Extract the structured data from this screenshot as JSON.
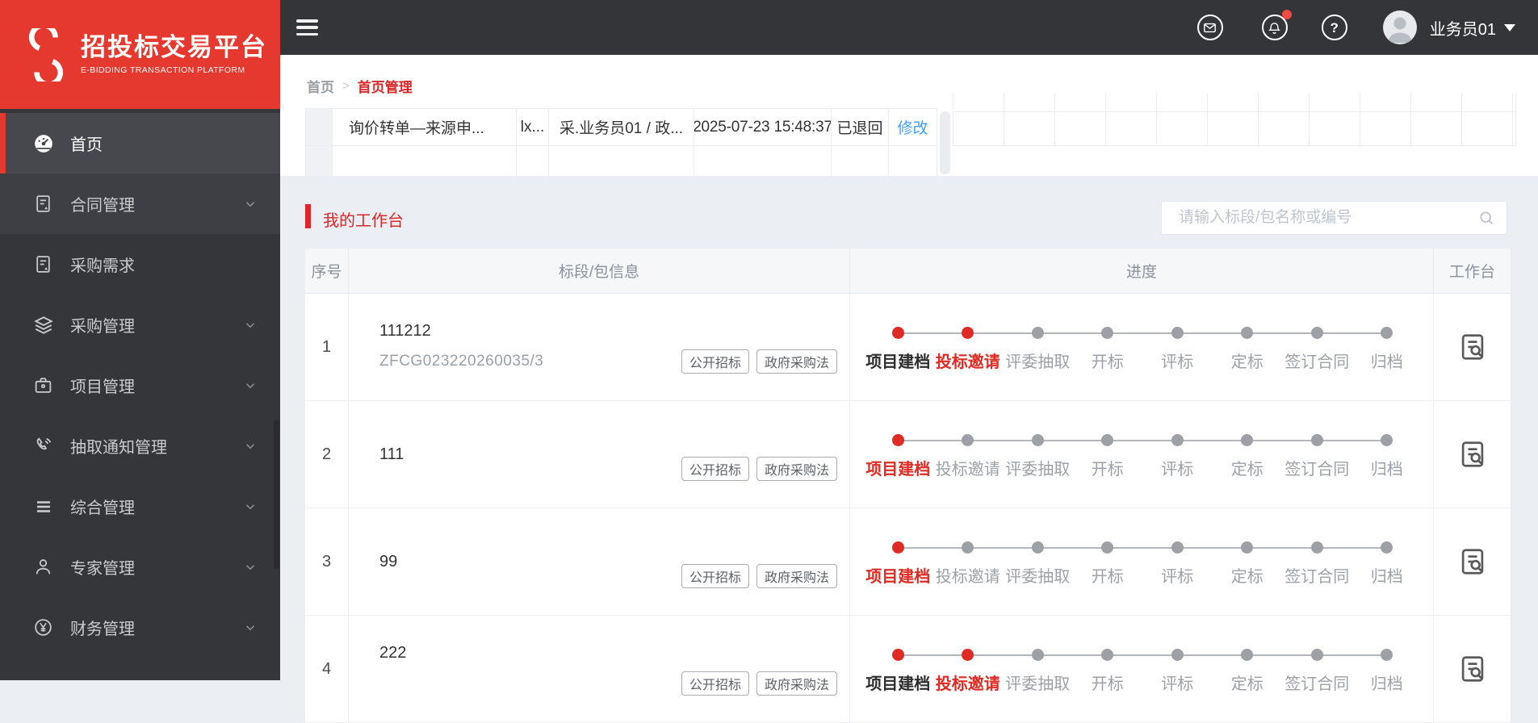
{
  "colors": {
    "accent_red": "#df2b24",
    "logo_red": "#e5382e",
    "link_blue": "#409eff",
    "dark_bar": "#343539",
    "sidebar_bg": "#35363a",
    "page_bg": "#ebeef2"
  },
  "brand": {
    "title": "招投标交易平台",
    "subtitle": "E-BIDDING TRANSACTION PLATFORM"
  },
  "topbar": {
    "username": "业务员01",
    "help_glyph": "?",
    "has_notification_dot": true,
    "icons": [
      "message-icon",
      "notification-bell-icon",
      "help-icon",
      "avatar",
      "caret-down-icon"
    ]
  },
  "breadcrumb": {
    "root": "首页",
    "separator": ">",
    "current": "首页管理"
  },
  "sidebar": {
    "items": [
      {
        "label": "首页",
        "icon": "dashboard-icon",
        "active": true,
        "expandable": false
      },
      {
        "label": "合同管理",
        "icon": "contract-doc-icon",
        "active": false,
        "expandable": true
      },
      {
        "label": "采购需求",
        "icon": "demand-doc-icon",
        "active": false,
        "expandable": false
      },
      {
        "label": "采购管理",
        "icon": "layers-icon",
        "active": false,
        "expandable": true
      },
      {
        "label": "项目管理",
        "icon": "briefcase-icon",
        "active": false,
        "expandable": true
      },
      {
        "label": "抽取通知管理",
        "icon": "phone-icon",
        "active": false,
        "expandable": true
      },
      {
        "label": "综合管理",
        "icon": "list-icon",
        "active": false,
        "expandable": true
      },
      {
        "label": "专家管理",
        "icon": "expert-person-icon",
        "active": false,
        "expandable": true
      },
      {
        "label": "财务管理",
        "icon": "finance-yuan-icon",
        "active": false,
        "expandable": true
      }
    ]
  },
  "recent_row": {
    "name": "询价转单—来源申...",
    "code": "lx...",
    "owner": "采.业务员01 / 政...",
    "time": "2025-07-23 15:48:37",
    "status": "已退回",
    "action": "修改"
  },
  "workbench": {
    "title": "我的工作台",
    "search_placeholder": "请输入标段/包名称或编号",
    "columns": [
      "序号",
      "标段/包信息",
      "进度",
      "工作台"
    ],
    "steps": [
      "项目建档",
      "投标邀请",
      "评委抽取",
      "开标",
      "评标",
      "定标",
      "签订合同",
      "归档"
    ],
    "rows": [
      {
        "seq": "1",
        "name": "111212",
        "code": "ZFCG023220260035/3",
        "tags": [
          "公开招标",
          "政府采购法"
        ],
        "completed_steps": [
          "项目建档"
        ],
        "current_step": "投标邀请",
        "has_second_line": true
      },
      {
        "seq": "2",
        "name": "111",
        "code": "",
        "tags": [
          "公开招标",
          "政府采购法"
        ],
        "completed_steps": [],
        "current_step": "项目建档",
        "has_second_line": false
      },
      {
        "seq": "3",
        "name": "99",
        "code": "",
        "tags": [
          "公开招标",
          "政府采购法"
        ],
        "completed_steps": [],
        "current_step": "项目建档",
        "has_second_line": false
      },
      {
        "seq": "4",
        "name": "222",
        "code": "",
        "tags": [
          "公开招标",
          "政府采购法"
        ],
        "completed_steps": [
          "项目建档"
        ],
        "current_step": "投标邀请",
        "has_second_line": true
      }
    ]
  }
}
